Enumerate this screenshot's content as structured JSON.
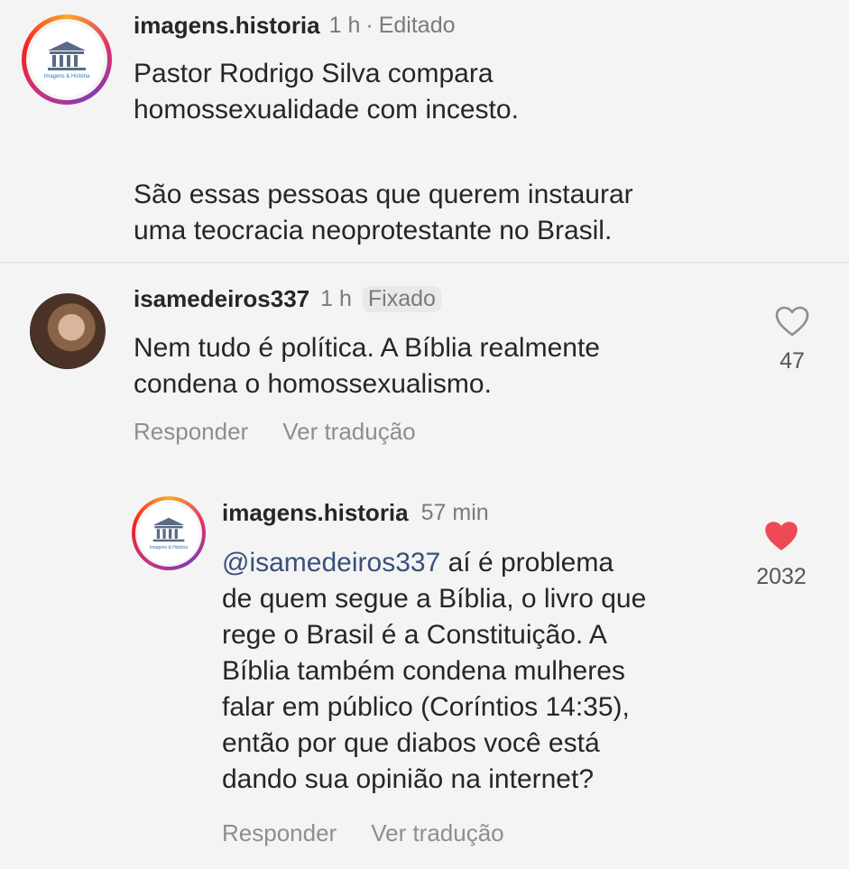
{
  "post": {
    "username": "imagens.historia",
    "time": "1 h",
    "separator": "·",
    "edited": "Editado",
    "lines": [
      "Pastor Rodrigo Silva compara",
      "homossexualidade com incesto.",
      "",
      "São essas pessoas que querem instaurar",
      "uma teocracia neoprotestante no Brasil."
    ],
    "avatar_logo_text": "Imagens & História"
  },
  "comment1": {
    "username": "isamedeiros337",
    "time": "1 h",
    "pinned": "Fixado",
    "lines": [
      "Nem tudo é política. A Bíblia realmente",
      "condena o homossexualismo."
    ],
    "likes": "47",
    "reply_label": "Responder",
    "translate_label": "Ver tradução",
    "like_icon": "heart-outline-icon"
  },
  "comment2": {
    "username": "imagens.historia",
    "time": "57 min",
    "mention": "@isamedeiros337",
    "first_line_rest": " aí é problema",
    "lines": [
      "de quem segue a Bíblia, o livro que",
      "rege o Brasil é a Constituição. A",
      "Bíblia também condena mulheres",
      "falar em público (Coríntios 14:35),",
      "então por que diabos você está",
      "dando sua opinião na internet?"
    ],
    "likes": "2032",
    "reply_label": "Responder",
    "translate_label": "Ver tradução",
    "like_icon": "heart-filled-icon",
    "like_color": "#ed4956",
    "avatar_logo_text": "Imagens & História"
  }
}
